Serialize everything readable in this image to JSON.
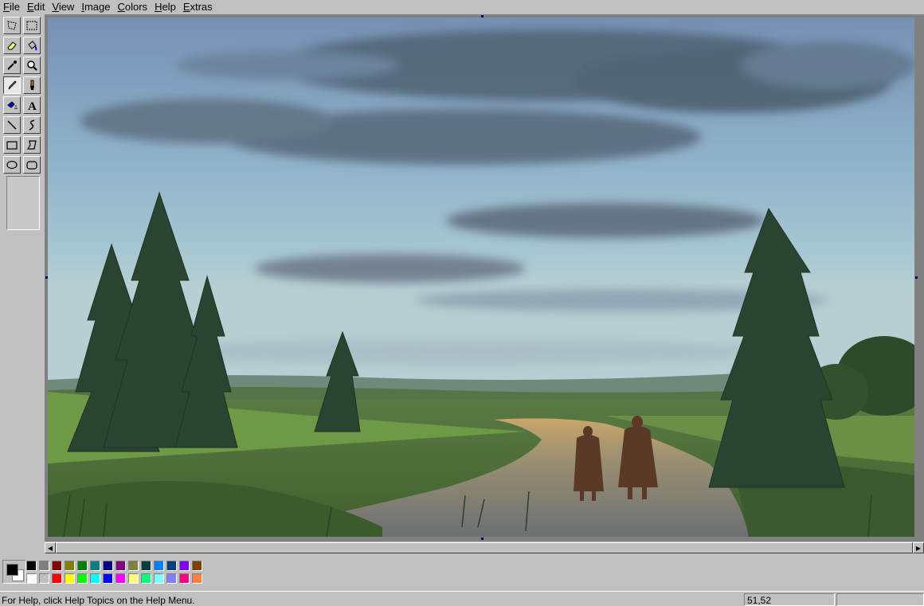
{
  "menu": {
    "items": [
      {
        "label": "File"
      },
      {
        "label": "Edit"
      },
      {
        "label": "View"
      },
      {
        "label": "Image"
      },
      {
        "label": "Colors"
      },
      {
        "label": "Help"
      },
      {
        "label": "Extras"
      }
    ]
  },
  "toolbox": {
    "tools": [
      {
        "name": "free-form-select-tool",
        "icon": "free-select-icon"
      },
      {
        "name": "rect-select-tool",
        "icon": "rect-select-icon"
      },
      {
        "name": "eraser-tool",
        "icon": "eraser-icon"
      },
      {
        "name": "fill-tool",
        "icon": "fill-bucket-icon"
      },
      {
        "name": "pick-color-tool",
        "icon": "eyedropper-icon"
      },
      {
        "name": "magnifier-tool",
        "icon": "magnifier-icon"
      },
      {
        "name": "pencil-tool",
        "icon": "pencil-icon",
        "active": true
      },
      {
        "name": "brush-tool",
        "icon": "brush-icon"
      },
      {
        "name": "airbrush-tool",
        "icon": "airbrush-icon"
      },
      {
        "name": "text-tool",
        "icon": "text-icon"
      },
      {
        "name": "line-tool",
        "icon": "line-icon"
      },
      {
        "name": "curve-tool",
        "icon": "curve-icon"
      },
      {
        "name": "rectangle-tool",
        "icon": "rectangle-icon"
      },
      {
        "name": "polygon-tool",
        "icon": "polygon-icon"
      },
      {
        "name": "ellipse-tool",
        "icon": "ellipse-icon"
      },
      {
        "name": "rounded-rectangle-tool",
        "icon": "rounded-rectangle-icon"
      }
    ],
    "text_tool_glyph": "A"
  },
  "colors": {
    "foreground": "#000000",
    "background": "#ffffff",
    "palette_top": [
      "#000000",
      "#808080",
      "#800000",
      "#808000",
      "#008000",
      "#008080",
      "#000080",
      "#800080",
      "#808040",
      "#004040",
      "#0080ff",
      "#004080",
      "#8000ff",
      "#804000"
    ],
    "palette_bottom": [
      "#ffffff",
      "#c0c0c0",
      "#ff0000",
      "#ffff00",
      "#00ff00",
      "#00ffff",
      "#0000ff",
      "#ff00ff",
      "#ffff80",
      "#00ff80",
      "#80ffff",
      "#8080ff",
      "#ff0080",
      "#ff8040"
    ]
  },
  "status": {
    "help_text": "For Help, click Help Topics on the Help Menu.",
    "coordinates": "51,52"
  }
}
